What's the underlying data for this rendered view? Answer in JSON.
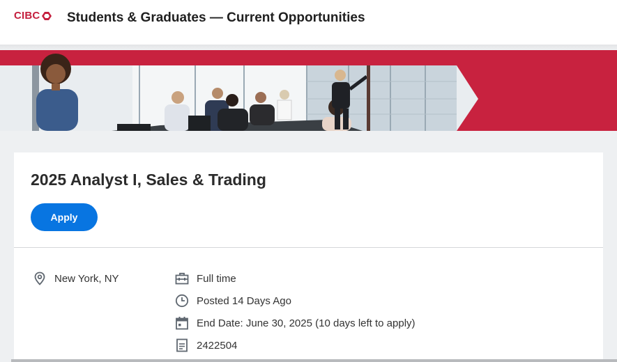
{
  "header": {
    "logo_text": "CIBC",
    "title": "Students & Graduates — Current Opportunities"
  },
  "banner": {
    "brand_color": "#c41f3e"
  },
  "job": {
    "title": "2025 Analyst I, Sales & Trading",
    "apply_label": "Apply",
    "location": "New York, NY",
    "time_type": "Full time",
    "posted": "Posted 14 Days Ago",
    "end_date": "End Date: June 30, 2025 (10 days left to apply)",
    "requisition_id": "2422504"
  },
  "icons": {
    "location": "location-pin-icon",
    "time_type": "briefcase-icon",
    "posted": "clock-icon",
    "end_date": "calendar-icon",
    "requisition": "document-icon"
  },
  "colors": {
    "accent": "#0875e1",
    "brand": "#c41f3e",
    "text": "#333333"
  }
}
